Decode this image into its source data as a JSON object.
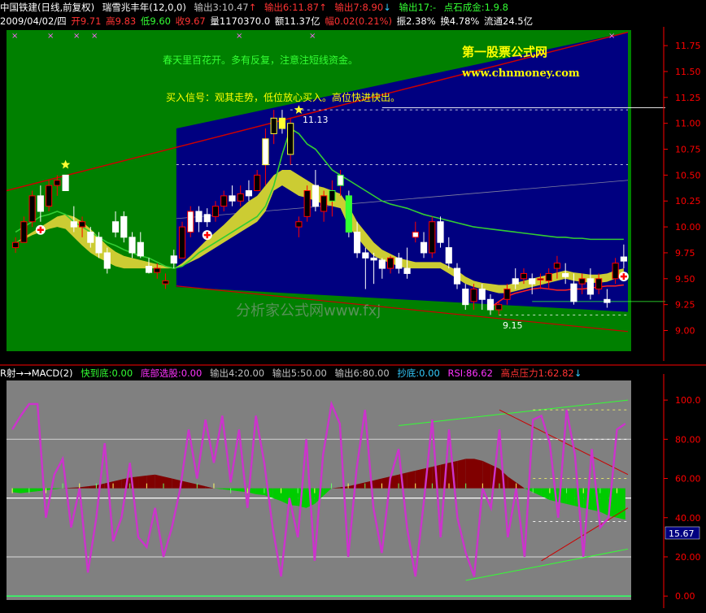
{
  "top_header": {
    "stock_name": "中国铁建",
    "period": "(日线,前复权)",
    "indicator_name": "瑞雪兆丰年(12,0,0)",
    "out3": "输出3:10.47",
    "out3_arrow": "↑",
    "out6": "输出6:11.87",
    "out6_arrow": "↑",
    "out7": "输出7:8.90",
    "out7_arrow": "↓",
    "out17": "输出17:-",
    "gold": "点石成金:1.9.8"
  },
  "quote_bar": {
    "date": "2009/04/02/四",
    "open": "开9.71",
    "high": "高9.83",
    "low": "低9.60",
    "close": "收9.67",
    "volume": "量1170370.0",
    "amount": "额11.37亿",
    "change": "幅0.02(0.21%)",
    "amplitude": "振2.38%",
    "turnover": "换4.78%",
    "float": "流通24.5亿"
  },
  "annotations": {
    "text1": "春天里百花开。多有反复，注意注短线资金。",
    "text2": "买入信号：观其走势，低位放心买入。高位快进快出。",
    "site_name": "第一股票公式网",
    "site_url": "www.chnmoney.com",
    "watermark": "分析家公式网www.fxj",
    "label_high": "11.13",
    "label_low": "9.15"
  },
  "lower_header": {
    "indicator": "R射→→MACD(2)",
    "fast_bottom": "快到底:0.00",
    "bottom_pick": "底部选股:0.00",
    "out4": "输出4:20.00",
    "out5": "输出5:50.00",
    "out6": "输出6:80.00",
    "copy_bottom": "抄底:0.00",
    "rsi": "RSI:86.62",
    "pressure": "高点压力1:62.82",
    "pressure_arrow": "↓"
  },
  "colors": {
    "background": "#000000",
    "price_panel": "#008000",
    "blue_zone": "#000080",
    "lower_panel": "#808080",
    "up_candle": "#ff0000",
    "down_candle": "#ffffff",
    "yellow_band": "#cccc33",
    "green_line": "#33cc33",
    "rsi_line": "#cc33cc",
    "axis": "#ff0000"
  },
  "chart_data": [
    {
      "type": "candlestick",
      "title": "中国铁建 (日线,前复权)",
      "ylim": [
        8.8,
        11.9
      ],
      "yticks": [
        "11.75",
        "11.50",
        "11.25",
        "11.00",
        "10.75",
        "10.50",
        "10.25",
        "10.00",
        "9.75",
        "9.50",
        "9.25",
        "9.00"
      ],
      "last_date": "2009/04/02",
      "last_ohlc": {
        "open": 9.71,
        "high": 9.83,
        "low": 9.6,
        "close": 9.67
      },
      "candles": [
        [
          9.8,
          9.9,
          9.75,
          9.85
        ],
        [
          9.85,
          10.1,
          9.85,
          10.05
        ],
        [
          10.05,
          10.35,
          10.0,
          10.3
        ],
        [
          10.3,
          10.4,
          10.05,
          10.15
        ],
        [
          10.2,
          10.45,
          10.15,
          10.4
        ],
        [
          10.4,
          10.5,
          10.3,
          10.45
        ],
        [
          10.5,
          10.5,
          10.35,
          10.35
        ],
        [
          10.05,
          10.2,
          9.95,
          10.0
        ],
        [
          10.0,
          10.1,
          9.9,
          10.05
        ],
        [
          9.95,
          10.0,
          9.8,
          9.85
        ],
        [
          9.9,
          9.95,
          9.7,
          9.75
        ],
        [
          9.75,
          9.8,
          9.55,
          9.6
        ],
        [
          10.05,
          10.15,
          9.9,
          9.95
        ],
        [
          10.1,
          10.15,
          9.85,
          9.9
        ],
        [
          9.9,
          9.95,
          9.7,
          9.75
        ],
        [
          9.85,
          9.95,
          9.7,
          9.72
        ],
        [
          9.62,
          9.7,
          9.55,
          9.56
        ],
        [
          9.56,
          9.65,
          9.5,
          9.6
        ],
        [
          9.45,
          9.55,
          9.4,
          9.48
        ],
        [
          9.72,
          9.78,
          9.6,
          9.65
        ],
        [
          9.7,
          10.05,
          9.7,
          10.0
        ],
        [
          9.95,
          10.2,
          9.9,
          10.15
        ],
        [
          10.15,
          10.2,
          9.95,
          10.05
        ],
        [
          10.12,
          10.18,
          10.0,
          10.05
        ],
        [
          10.1,
          10.25,
          10.05,
          10.2
        ],
        [
          10.2,
          10.35,
          10.15,
          10.3
        ],
        [
          10.3,
          10.4,
          10.2,
          10.25
        ],
        [
          10.25,
          10.4,
          10.2,
          10.32
        ],
        [
          10.35,
          10.45,
          10.25,
          10.3
        ],
        [
          10.35,
          10.55,
          10.35,
          10.5
        ],
        [
          10.6,
          10.95,
          10.4,
          10.85
        ],
        [
          10.9,
          11.13,
          10.8,
          11.05
        ],
        [
          11.05,
          11.13,
          10.9,
          10.95
        ],
        [
          10.7,
          11.05,
          10.6,
          11.0
        ],
        [
          10.0,
          10.1,
          9.9,
          10.05
        ],
        [
          10.1,
          10.4,
          10.05,
          10.35
        ],
        [
          10.4,
          10.55,
          10.15,
          10.2
        ],
        [
          10.15,
          10.35,
          10.05,
          10.3
        ],
        [
          10.25,
          10.45,
          10.1,
          10.35
        ],
        [
          10.4,
          10.55,
          10.3,
          10.5
        ],
        [
          10.3,
          10.35,
          9.9,
          9.95
        ],
        [
          9.95,
          10.05,
          9.7,
          9.75
        ],
        [
          9.75,
          9.8,
          9.4,
          9.7
        ],
        [
          9.7,
          9.75,
          9.45,
          9.68
        ],
        [
          9.68,
          9.7,
          9.5,
          9.6
        ],
        [
          9.6,
          9.72,
          9.55,
          9.7
        ],
        [
          9.7,
          9.75,
          9.55,
          9.6
        ],
        [
          9.6,
          9.8,
          9.5,
          9.55
        ],
        [
          9.9,
          10.05,
          9.85,
          9.95
        ],
        [
          9.85,
          9.95,
          9.7,
          9.75
        ],
        [
          9.75,
          10.1,
          9.7,
          10.05
        ],
        [
          10.05,
          10.1,
          9.8,
          9.85
        ],
        [
          9.8,
          9.9,
          9.6,
          9.65
        ],
        [
          9.6,
          9.65,
          9.4,
          9.45
        ],
        [
          9.4,
          9.45,
          9.2,
          9.25
        ],
        [
          9.28,
          9.45,
          9.2,
          9.4
        ],
        [
          9.4,
          9.45,
          9.2,
          9.3
        ],
        [
          9.3,
          9.35,
          9.15,
          9.2
        ],
        [
          9.2,
          9.28,
          9.15,
          9.25
        ],
        [
          9.3,
          9.45,
          9.25,
          9.4
        ],
        [
          9.5,
          9.6,
          9.4,
          9.45
        ],
        [
          9.5,
          9.6,
          9.45,
          9.55
        ],
        [
          9.5,
          9.55,
          9.35,
          9.45
        ],
        [
          9.5,
          9.55,
          9.4,
          9.5
        ],
        [
          9.48,
          9.6,
          9.4,
          9.55
        ],
        [
          9.6,
          9.72,
          9.5,
          9.65
        ],
        [
          9.55,
          9.65,
          9.45,
          9.52
        ],
        [
          9.45,
          9.55,
          9.25,
          9.28
        ],
        [
          9.45,
          9.55,
          9.35,
          9.5
        ],
        [
          9.5,
          9.6,
          9.3,
          9.35
        ],
        [
          9.4,
          9.55,
          9.35,
          9.5
        ],
        [
          9.3,
          9.4,
          9.22,
          9.27
        ],
        [
          9.5,
          9.7,
          9.45,
          9.65
        ],
        [
          9.71,
          9.83,
          9.6,
          9.67
        ]
      ],
      "ma_green": [
        9.95,
        10.0,
        10.05,
        10.1,
        10.12,
        10.15,
        10.12,
        10.05,
        10.0,
        9.95,
        9.9,
        9.85,
        9.82,
        9.78,
        9.75,
        9.72,
        9.7,
        9.66,
        9.62,
        9.6,
        9.62,
        9.68,
        9.75,
        9.8,
        9.85,
        9.9,
        9.95,
        10.0,
        10.05,
        10.1,
        10.2,
        10.4,
        10.7,
        10.95,
        10.9,
        10.8,
        10.75,
        10.65,
        10.55,
        10.5,
        10.45,
        10.4,
        10.35,
        10.3,
        10.25,
        10.22,
        10.2,
        10.18,
        10.15,
        10.12,
        10.1,
        10.08,
        10.06,
        10.04,
        10.02,
        10.0,
        9.99,
        9.98,
        9.97,
        9.96,
        9.95,
        9.94,
        9.93,
        9.92,
        9.91,
        9.9,
        9.9,
        9.89,
        9.89,
        9.88,
        9.88,
        9.88,
        9.88,
        9.88
      ],
      "yellow_band_low": [
        9.85,
        9.88,
        9.92,
        9.95,
        9.98,
        10.0,
        9.98,
        9.9,
        9.82,
        9.75,
        9.7,
        9.66,
        9.62,
        9.6,
        9.6,
        9.6,
        9.6,
        9.6,
        9.6,
        9.6,
        9.62,
        9.66,
        9.7,
        9.75,
        9.8,
        9.85,
        9.9,
        9.95,
        10.0,
        10.05,
        10.15,
        10.35,
        10.4,
        10.35,
        10.3,
        10.28,
        10.25,
        10.22,
        10.2,
        10.18,
        10.0,
        9.9,
        9.8,
        9.72,
        9.68,
        9.65,
        9.62,
        9.6,
        9.6,
        9.6,
        9.6,
        9.6,
        9.55,
        9.5,
        9.45,
        9.42,
        9.4,
        9.38,
        9.36,
        9.36,
        9.38,
        9.4,
        9.42,
        9.44,
        9.46,
        9.48,
        9.5,
        9.48,
        9.47,
        9.46,
        9.46,
        9.47,
        9.5,
        9.52
      ],
      "yellow_band_high": [
        9.85,
        9.9,
        9.95,
        10.0,
        10.05,
        10.1,
        10.12,
        10.1,
        10.05,
        9.98,
        9.9,
        9.82,
        9.76,
        9.72,
        9.7,
        9.68,
        9.66,
        9.64,
        9.62,
        9.6,
        9.65,
        9.72,
        9.8,
        9.88,
        9.95,
        10.02,
        10.1,
        10.18,
        10.25,
        10.3,
        10.4,
        10.5,
        10.55,
        10.55,
        10.5,
        10.45,
        10.4,
        10.38,
        10.35,
        10.32,
        10.2,
        10.05,
        9.95,
        9.85,
        9.78,
        9.74,
        9.7,
        9.68,
        9.66,
        9.66,
        9.66,
        9.66,
        9.62,
        9.58,
        9.52,
        9.48,
        9.46,
        9.45,
        9.44,
        9.44,
        9.46,
        9.48,
        9.5,
        9.52,
        9.54,
        9.56,
        9.58,
        9.56,
        9.55,
        9.54,
        9.54,
        9.55,
        9.58,
        9.6
      ],
      "red_markers": [
        3,
        23,
        73
      ],
      "star_markers": [
        {
          "index": 6,
          "price": 10.6
        },
        {
          "index": 34,
          "price": 11.13
        }
      ]
    },
    {
      "type": "line",
      "title": "R射→→MACD(2)",
      "ylim": [
        -2,
        110
      ],
      "yticks": [
        "100.0",
        "80.00",
        "60.00",
        "40.00",
        "20.00",
        "0.00"
      ],
      "current_value": "15.67",
      "series": [
        {
          "name": "RSI",
          "values": [
            85,
            92,
            98,
            98,
            40,
            62,
            70,
            35,
            55,
            12,
            40,
            78,
            28,
            40,
            68,
            30,
            25,
            45,
            20,
            35,
            55,
            85,
            60,
            90,
            68,
            92,
            58,
            85,
            45,
            92,
            68,
            35,
            10,
            50,
            30,
            80,
            18,
            72,
            98,
            88,
            20,
            65,
            95,
            45,
            22,
            60,
            75,
            35,
            10,
            48,
            90,
            30,
            85,
            40,
            22,
            10,
            55,
            45,
            85,
            30,
            55,
            20,
            90,
            92,
            78,
            40,
            95,
            72,
            20,
            75,
            35,
            40,
            85,
            88
          ]
        }
      ],
      "macd": [
        -2,
        -2.5,
        -2,
        -1.5,
        -1,
        -0.5,
        0,
        0.3,
        0.5,
        1,
        1.5,
        2.5,
        3.5,
        4.5,
        5.5,
        6,
        6.5,
        7,
        6,
        5,
        4,
        3,
        2,
        1,
        0,
        -0.5,
        -1,
        -1.5,
        -2,
        -3,
        -3.5,
        -5,
        -6.5,
        -8.5,
        -9,
        -10,
        -8,
        -4,
        0,
        0.5,
        1,
        2,
        3,
        4,
        5,
        6,
        7,
        8,
        9,
        10,
        11,
        12,
        13,
        14,
        15,
        15,
        14,
        12,
        10,
        6,
        3,
        0,
        -2,
        -4,
        -6,
        -7,
        -8,
        -9,
        -10,
        -11,
        -12,
        -14,
        -15,
        -16
      ]
    }
  ]
}
